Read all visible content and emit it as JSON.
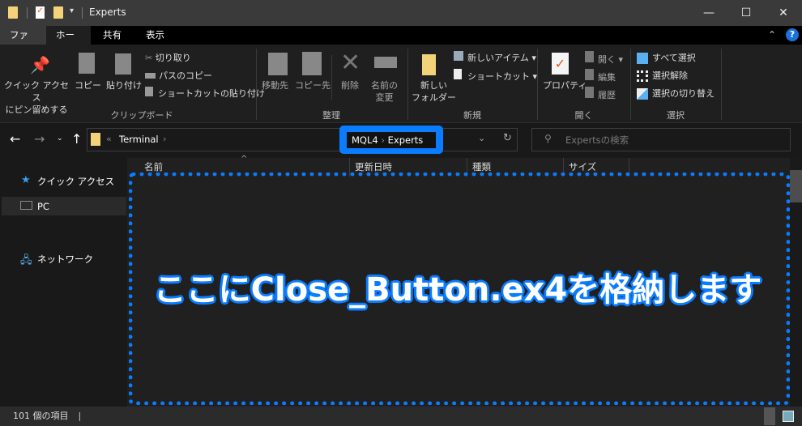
{
  "window": {
    "title": "Experts",
    "minimize": "—",
    "maximize": "☐",
    "close": "✕"
  },
  "tabs": [
    {
      "label": "ファイル"
    },
    {
      "label": "ホーム"
    },
    {
      "label": "共有"
    },
    {
      "label": "表示"
    }
  ],
  "help": "?",
  "ribbon": {
    "clipboard": {
      "pin": "クイック アクセス\nにピン留めする",
      "copy": "コピー",
      "paste": "貼り付け",
      "cut": "切り取り",
      "copy_path": "パスのコピー",
      "paste_shortcut": "ショートカットの貼り付け",
      "group": "クリップボード"
    },
    "organize": {
      "move_to": "移動先",
      "copy_to": "コピー先",
      "delete": "削除",
      "rename": "名前の\n変更",
      "group": "整理"
    },
    "new": {
      "new_folder": "新しい\nフォルダー",
      "new_item": "新しいアイテム",
      "shortcut": "ショートカット",
      "group": "新規"
    },
    "open": {
      "properties": "プロパティ",
      "open": "開く",
      "edit": "編集",
      "history": "履歴",
      "group": "開く"
    },
    "select": {
      "select_all": "すべて選択",
      "select_none": "選択解除",
      "invert": "選択の切り替え",
      "group": "選択"
    }
  },
  "address": {
    "prefix": "«",
    "segments": [
      "Terminal",
      "MQL4",
      "Experts"
    ],
    "sep": "›"
  },
  "search": {
    "placeholder": "Expertsの検索"
  },
  "nav_pane": [
    {
      "label": "クイック アクセス"
    },
    {
      "label": "PC"
    },
    {
      "label": "ネットワーク"
    }
  ],
  "columns": [
    "名前",
    "更新日時",
    "種類",
    "サイズ"
  ],
  "overlay": "ここにClose_Button.ex4を格納します",
  "status": {
    "count": "101 個の項目"
  },
  "colors": {
    "accent": "#0a7cff"
  }
}
